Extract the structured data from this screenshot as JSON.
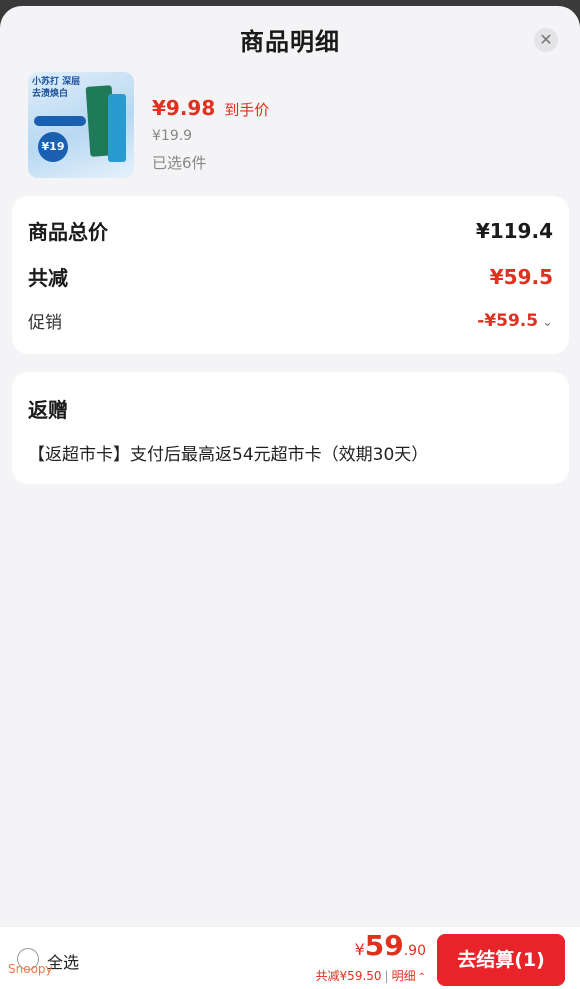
{
  "header": {
    "title": "商品明细",
    "close_icon": "close-icon"
  },
  "product": {
    "image_alt": "toothpaste-product-image",
    "image_badge": "¥19",
    "image_tag": "小苏打 深层去渍焕白",
    "price": "¥9.98",
    "price_tag": "到手价",
    "original_price": "¥19.9",
    "selected": "已选6件"
  },
  "summary": {
    "total_label": "商品总价",
    "total_value": "¥119.4",
    "reduce_label": "共减",
    "reduce_value": "¥59.5",
    "promo_label": "促销",
    "promo_value": "-¥59.5"
  },
  "gift": {
    "title": "返赠",
    "text": "【返超市卡】支付后最高返54元超市卡（效期30天）"
  },
  "footer": {
    "select_all": "全选",
    "currency": "¥",
    "amount_int": "59",
    "amount_dec": ".90",
    "reduce_text": "共减¥59.50",
    "separator": "|",
    "detail_label": "明细",
    "checkout_label": "去结算(1)"
  },
  "watermark": "Snoopy",
  "colors": {
    "accent": "#e0301e",
    "button": "#e8232a",
    "background": "#f4f4f6"
  }
}
